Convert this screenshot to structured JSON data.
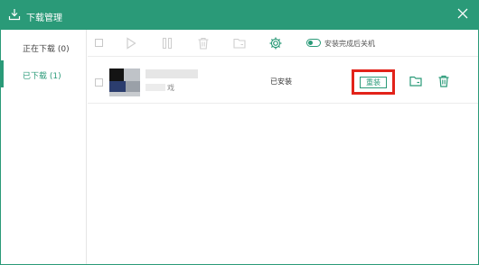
{
  "window": {
    "title": "下载管理"
  },
  "sidebar": {
    "items": [
      {
        "label": "正在下载 (0)",
        "active": false
      },
      {
        "label": "已下载 (1)",
        "active": true
      }
    ]
  },
  "toolbar": {
    "auto_shutdown_label": "安装完成后关机",
    "auto_shutdown_enabled": false
  },
  "downloads": [
    {
      "name_visible_suffix": "戏",
      "status": "已安装",
      "action_label": "重装"
    }
  ],
  "colors": {
    "accent": "#2a9a78",
    "highlight": "#e2231a"
  }
}
